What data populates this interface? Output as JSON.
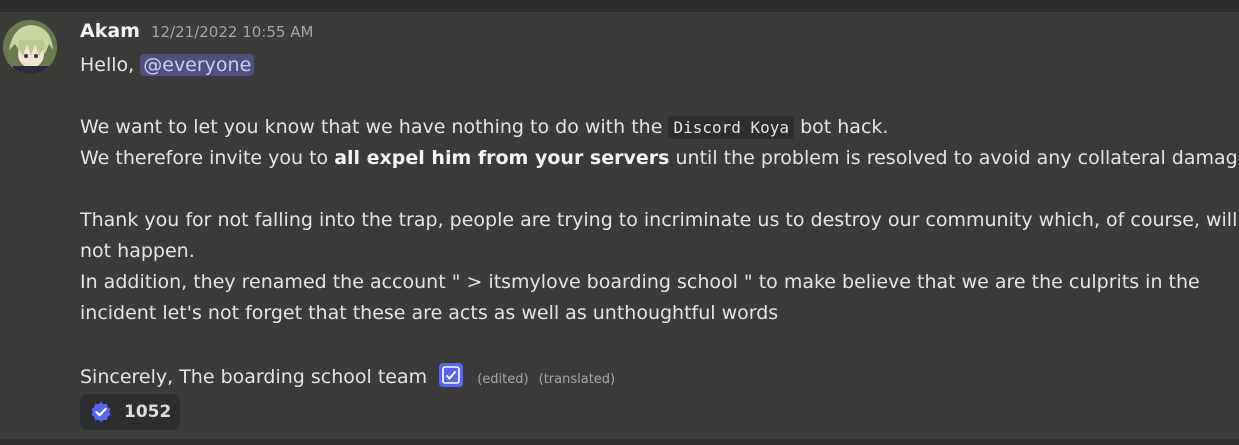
{
  "message": {
    "author": "Akam",
    "timestamp": "12/21/2022 10:55 AM",
    "greeting": "Hello,",
    "mention": "@everyone",
    "p1_before": "We want to let you know that we have nothing to do with the",
    "p1_code": "Discord Koya",
    "p1_after": "bot hack.",
    "p2_before": "We therefore invite you to",
    "p2_bold": "all expel him from your servers",
    "p2_after": "until the problem is resolved to avoid any collateral damage.",
    "p3_line1": "Thank you for not falling into the trap, people are trying to incriminate us to destroy our community which, of course, will",
    "p3_line2": "not happen.",
    "p4_line1": "In addition, they renamed the account \" > itsmylove boarding school \" to make believe that we are the culprits in the",
    "p4_line2": "incident let's not forget that these are acts as well as unthoughtful words",
    "signature": "Sincerely, The boarding school team",
    "edited": "(edited)",
    "translated": "(translated)"
  },
  "reaction": {
    "icon": "verified-check-icon",
    "count": "1052"
  },
  "colors": {
    "background": "#3b3b3a",
    "mention_bg": "#505080",
    "badge": "#5865f2"
  }
}
